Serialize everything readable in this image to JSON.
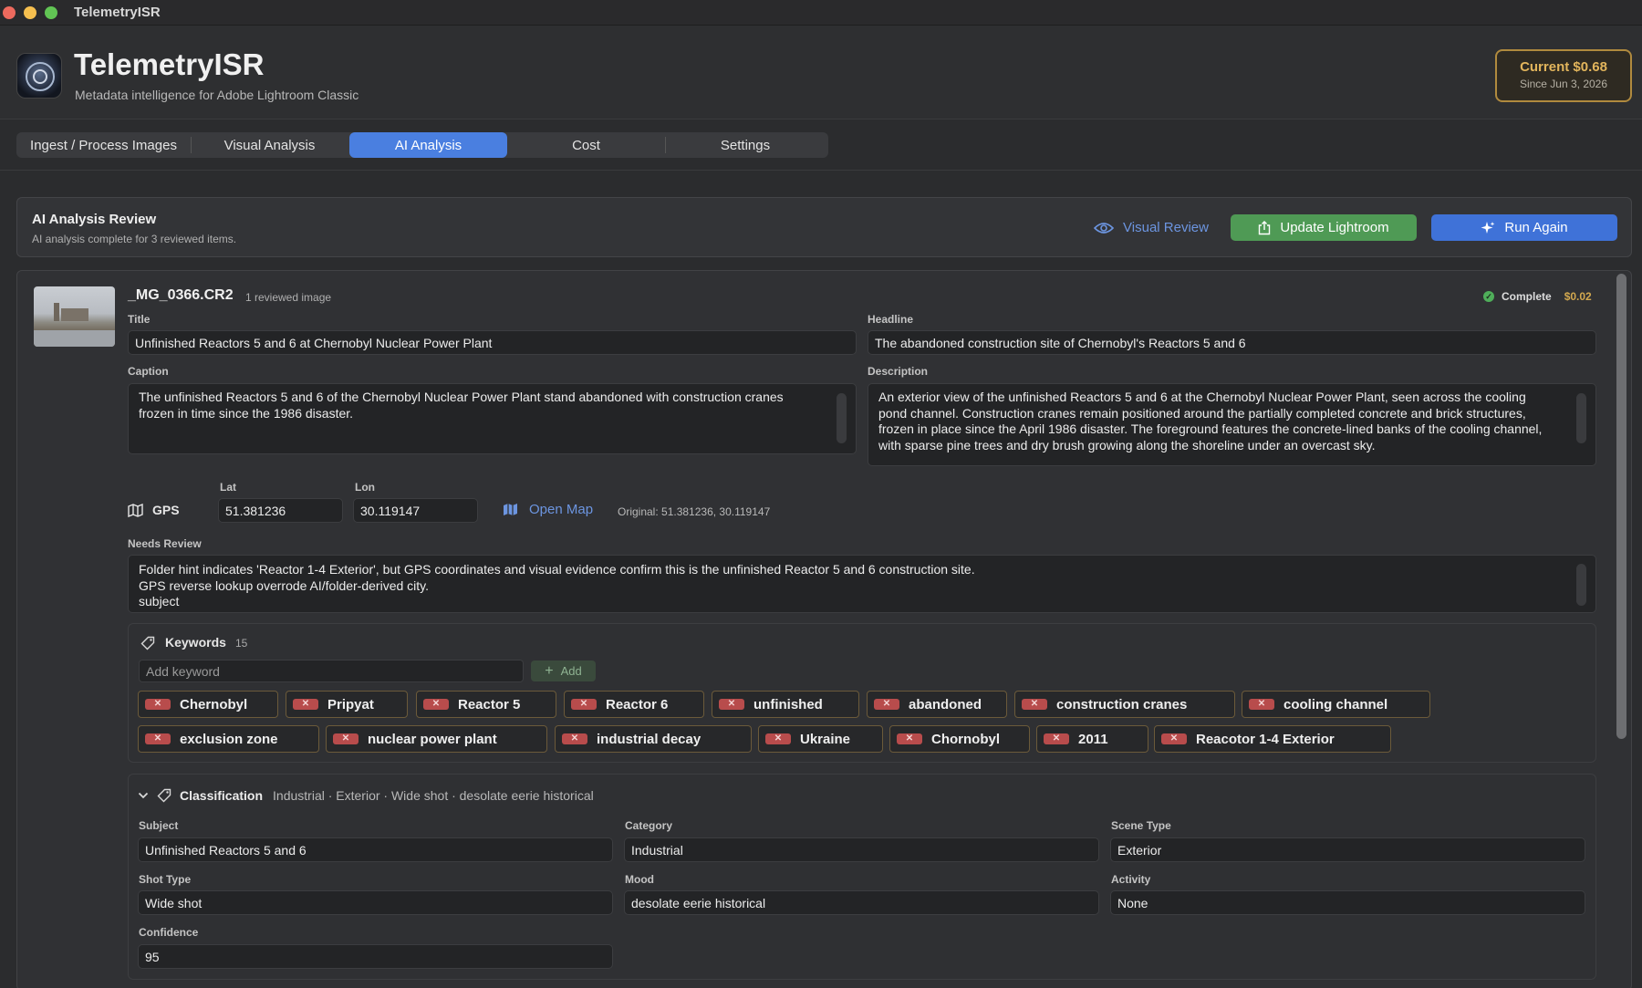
{
  "window": {
    "title": "TelemetryISR"
  },
  "header": {
    "app_name": "TelemetryISR",
    "subtitle": "Metadata intelligence for Adobe Lightroom Classic",
    "cost_current": "Current $0.68",
    "cost_since": "Since Jun 3, 2026"
  },
  "tabs": [
    {
      "label": "Ingest / Process Images",
      "active": false
    },
    {
      "label": "Visual Analysis",
      "active": false
    },
    {
      "label": "AI Analysis",
      "active": true
    },
    {
      "label": "Cost",
      "active": false
    },
    {
      "label": "Settings",
      "active": false
    }
  ],
  "review": {
    "title": "AI Analysis Review",
    "subtitle": "AI analysis complete for 3 reviewed items.",
    "visual_review": "Visual Review",
    "update_lightroom": "Update Lightroom",
    "run_again": "Run Again"
  },
  "item": {
    "filename": "_MG_0366.CR2",
    "reviewed": "1 reviewed image",
    "status": "Complete",
    "price": "$0.02",
    "title_label": "Title",
    "title_value": "Unfinished Reactors 5 and 6 at Chernobyl Nuclear Power Plant",
    "headline_label": "Headline",
    "headline_value": "The abandoned construction site of Chernobyl's Reactors 5 and 6",
    "caption_label": "Caption",
    "caption_value": "The unfinished Reactors 5 and 6 of the Chernobyl Nuclear Power Plant stand abandoned with construction cranes frozen in time since the 1986 disaster.",
    "description_label": "Description",
    "description_value": "An exterior view of the unfinished Reactors 5 and 6 at the Chernobyl Nuclear Power Plant, seen across the cooling pond channel. Construction cranes remain positioned around the partially completed concrete and brick structures, frozen in place since the April 1986 disaster. The foreground features the concrete-lined banks of the cooling channel, with sparse pine trees and dry brush growing along the shoreline under an overcast sky.",
    "gps_label": "GPS",
    "lat_label": "Lat",
    "lat_value": "51.381236",
    "lon_label": "Lon",
    "lon_value": "30.119147",
    "open_map": "Open Map",
    "original": "Original: 51.381236, 30.119147",
    "needs_review_label": "Needs Review",
    "needs_review_lines": [
      "Folder hint indicates 'Reactor 1-4 Exterior', but GPS coordinates and visual evidence confirm this is the unfinished Reactor 5 and 6 construction site.",
      "GPS reverse lookup overrode AI/folder-derived city.",
      "subject"
    ]
  },
  "keywords": {
    "title": "Keywords",
    "count": "15",
    "placeholder": "Add keyword",
    "add_label": "Add",
    "items": [
      "Chernobyl",
      "Pripyat",
      "Reactor 5",
      "Reactor 6",
      "unfinished",
      "abandoned",
      "construction cranes",
      "cooling channel",
      "exclusion zone",
      "nuclear power plant",
      "industrial decay",
      "Ukraine",
      "Chornobyl",
      "2011",
      "Reacotor 1-4 Exterior"
    ]
  },
  "classification": {
    "title": "Classification",
    "summary": "Industrial · Exterior · Wide shot · desolate eerie historical",
    "subject_label": "Subject",
    "subject_value": "Unfinished Reactors 5 and 6",
    "category_label": "Category",
    "category_value": "Industrial",
    "scene_label": "Scene Type",
    "scene_value": "Exterior",
    "shot_label": "Shot Type",
    "shot_value": "Wide shot",
    "mood_label": "Mood",
    "mood_value": "desolate eerie historical",
    "activity_label": "Activity",
    "activity_value": "None",
    "confidence_label": "Confidence",
    "confidence_value": "95"
  },
  "colors": {
    "accent_blue": "#4a7fe0",
    "update_green": "#4f9a55",
    "cost_gold": "#e2b55c",
    "remove_red": "#b84c4c"
  },
  "icons": {
    "app": "app-logo-icon",
    "visual_review": "eye-icon",
    "update_lightroom": "export-icon",
    "run_again": "sparkle-icon",
    "gps": "map-icon",
    "open_map": "map-fill-icon",
    "keywords": "tag-icon",
    "classification": "tag-icon",
    "collapse": "chevron-down-icon",
    "complete": "check-circle-icon",
    "remove_keyword": "close-icon"
  }
}
